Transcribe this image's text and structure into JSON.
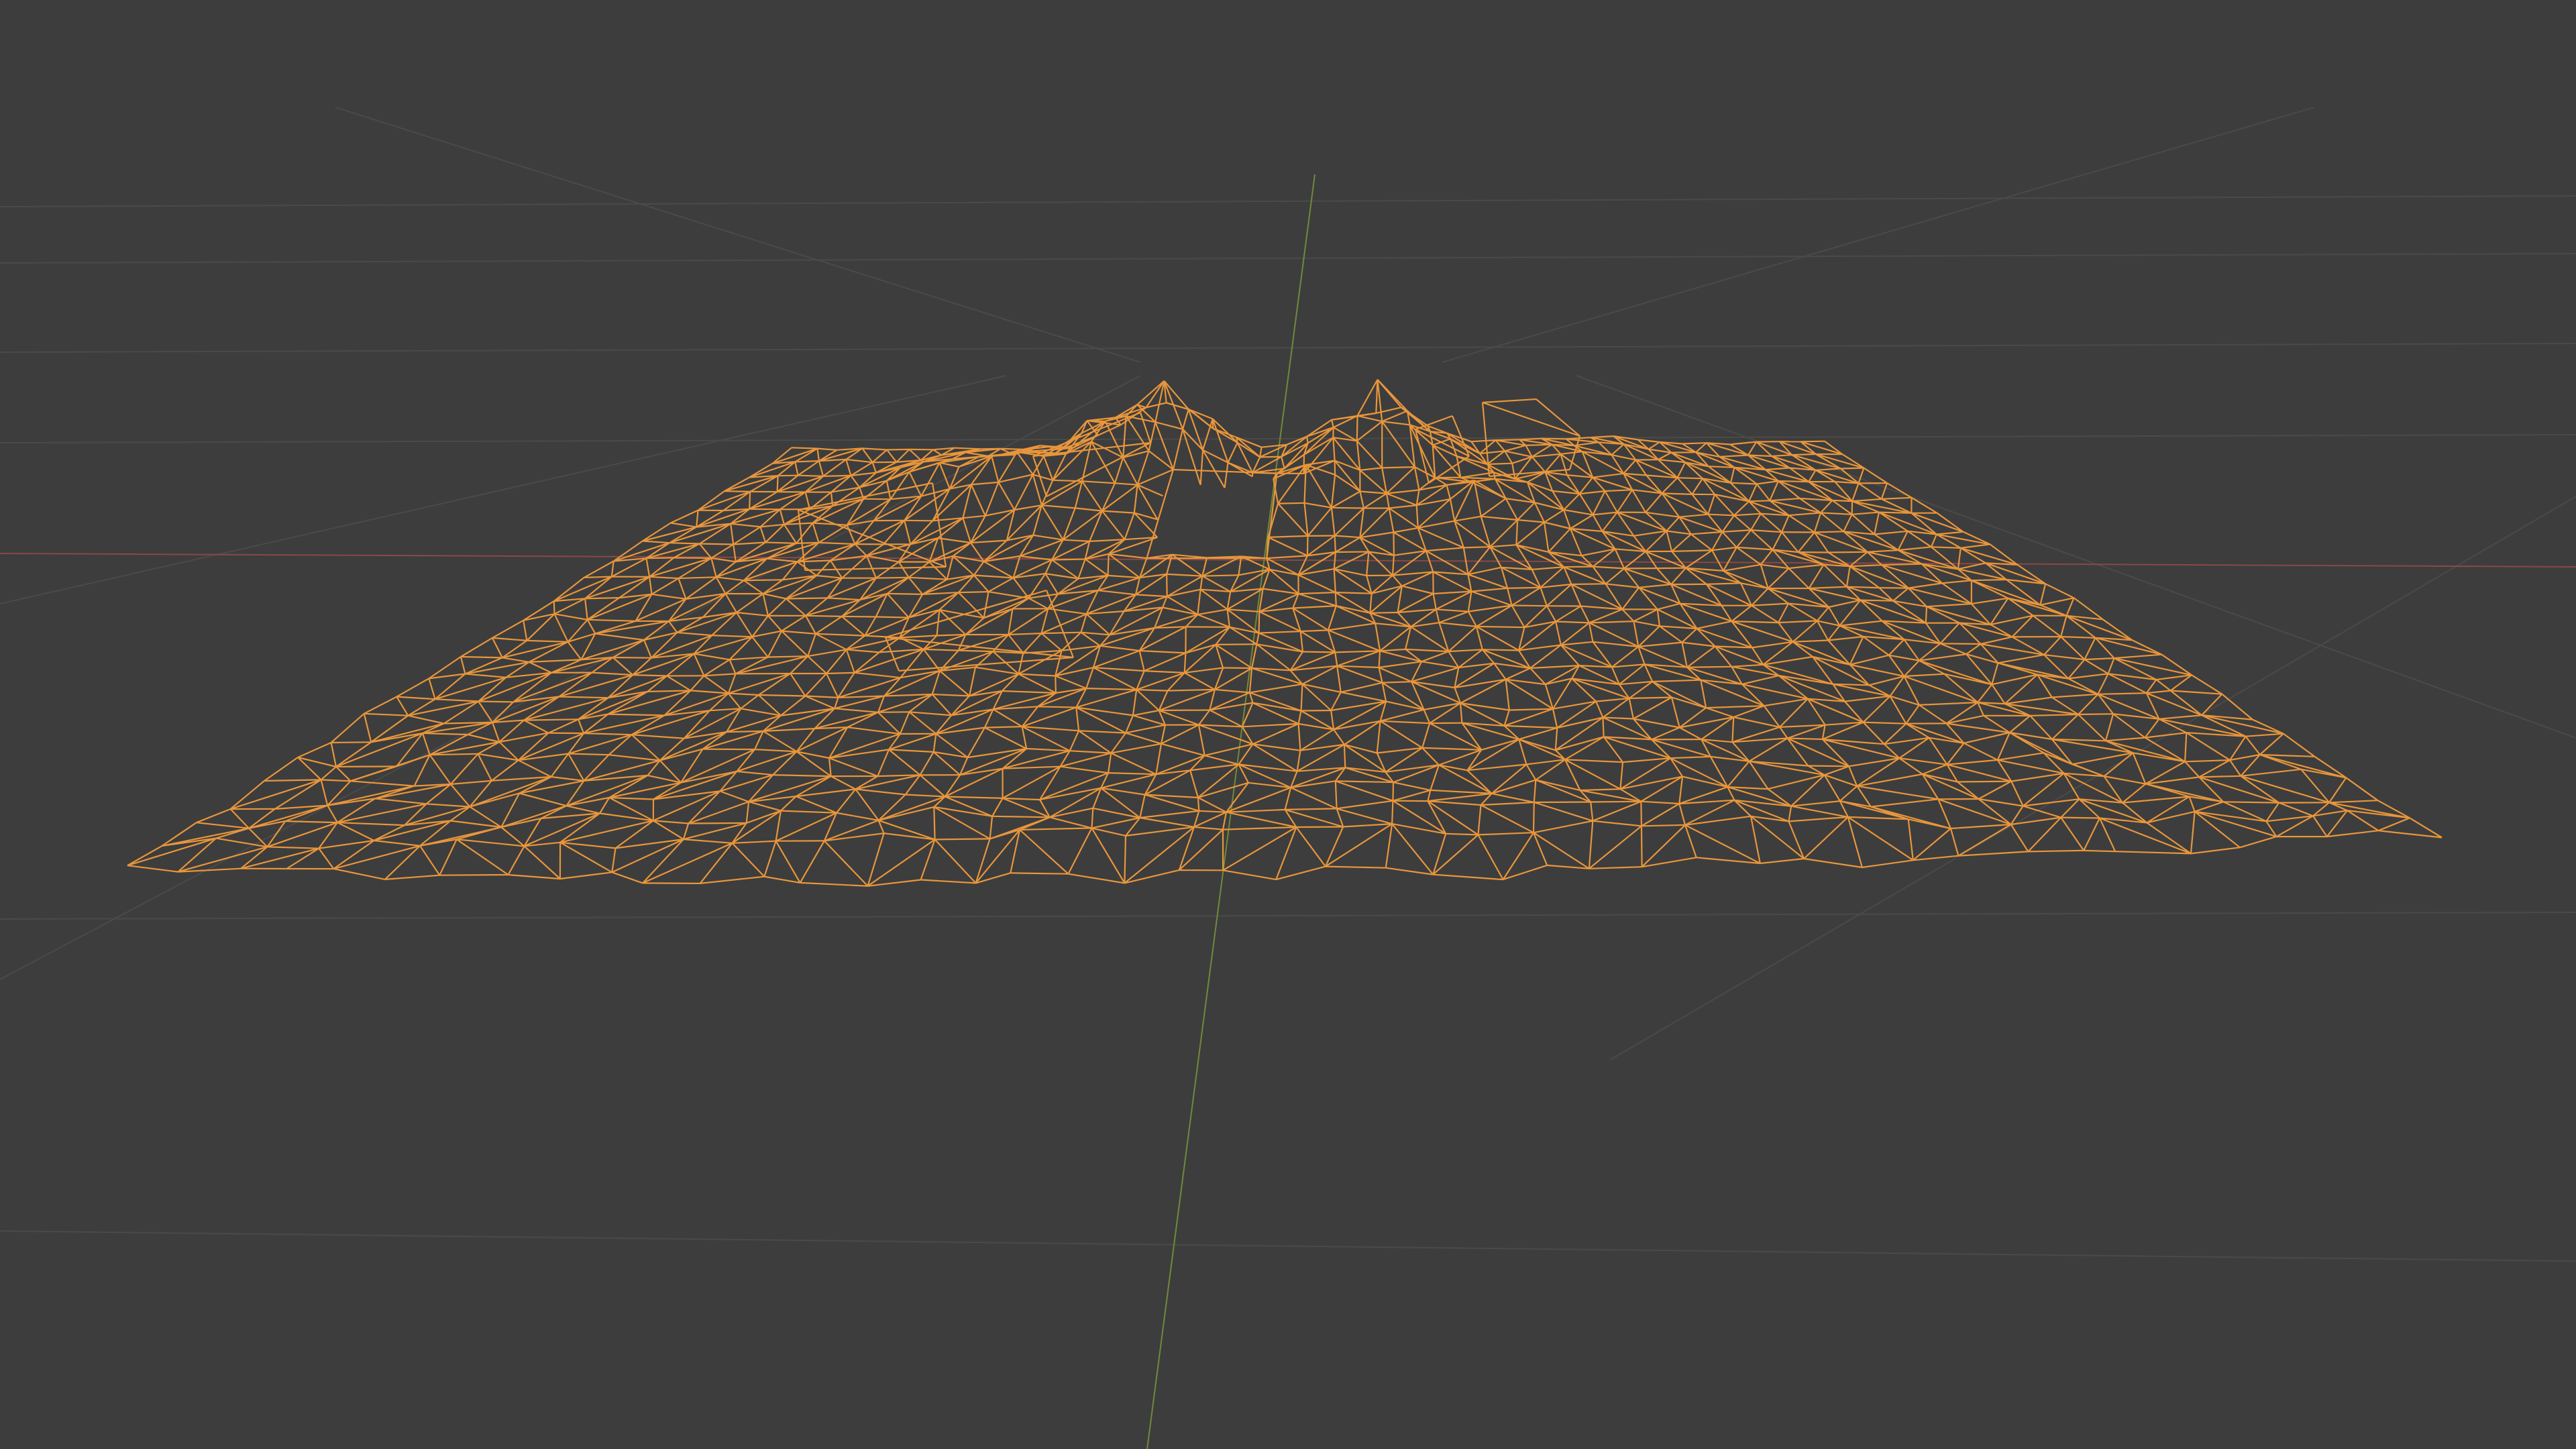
{
  "viewport": {
    "background_color": "#3d3d3d",
    "view_mode": "wireframe",
    "perspective": true
  },
  "grid": {
    "visible": true,
    "line_color": "#4a4a4a",
    "x_axis_color": "#8a4848",
    "y_axis_color": "#6f8a3a"
  },
  "mesh": {
    "name": "",
    "selected": true,
    "wire_color": "#e8963c",
    "shape": "terrain-scan",
    "features": [
      "rocks",
      "central-pit"
    ]
  }
}
